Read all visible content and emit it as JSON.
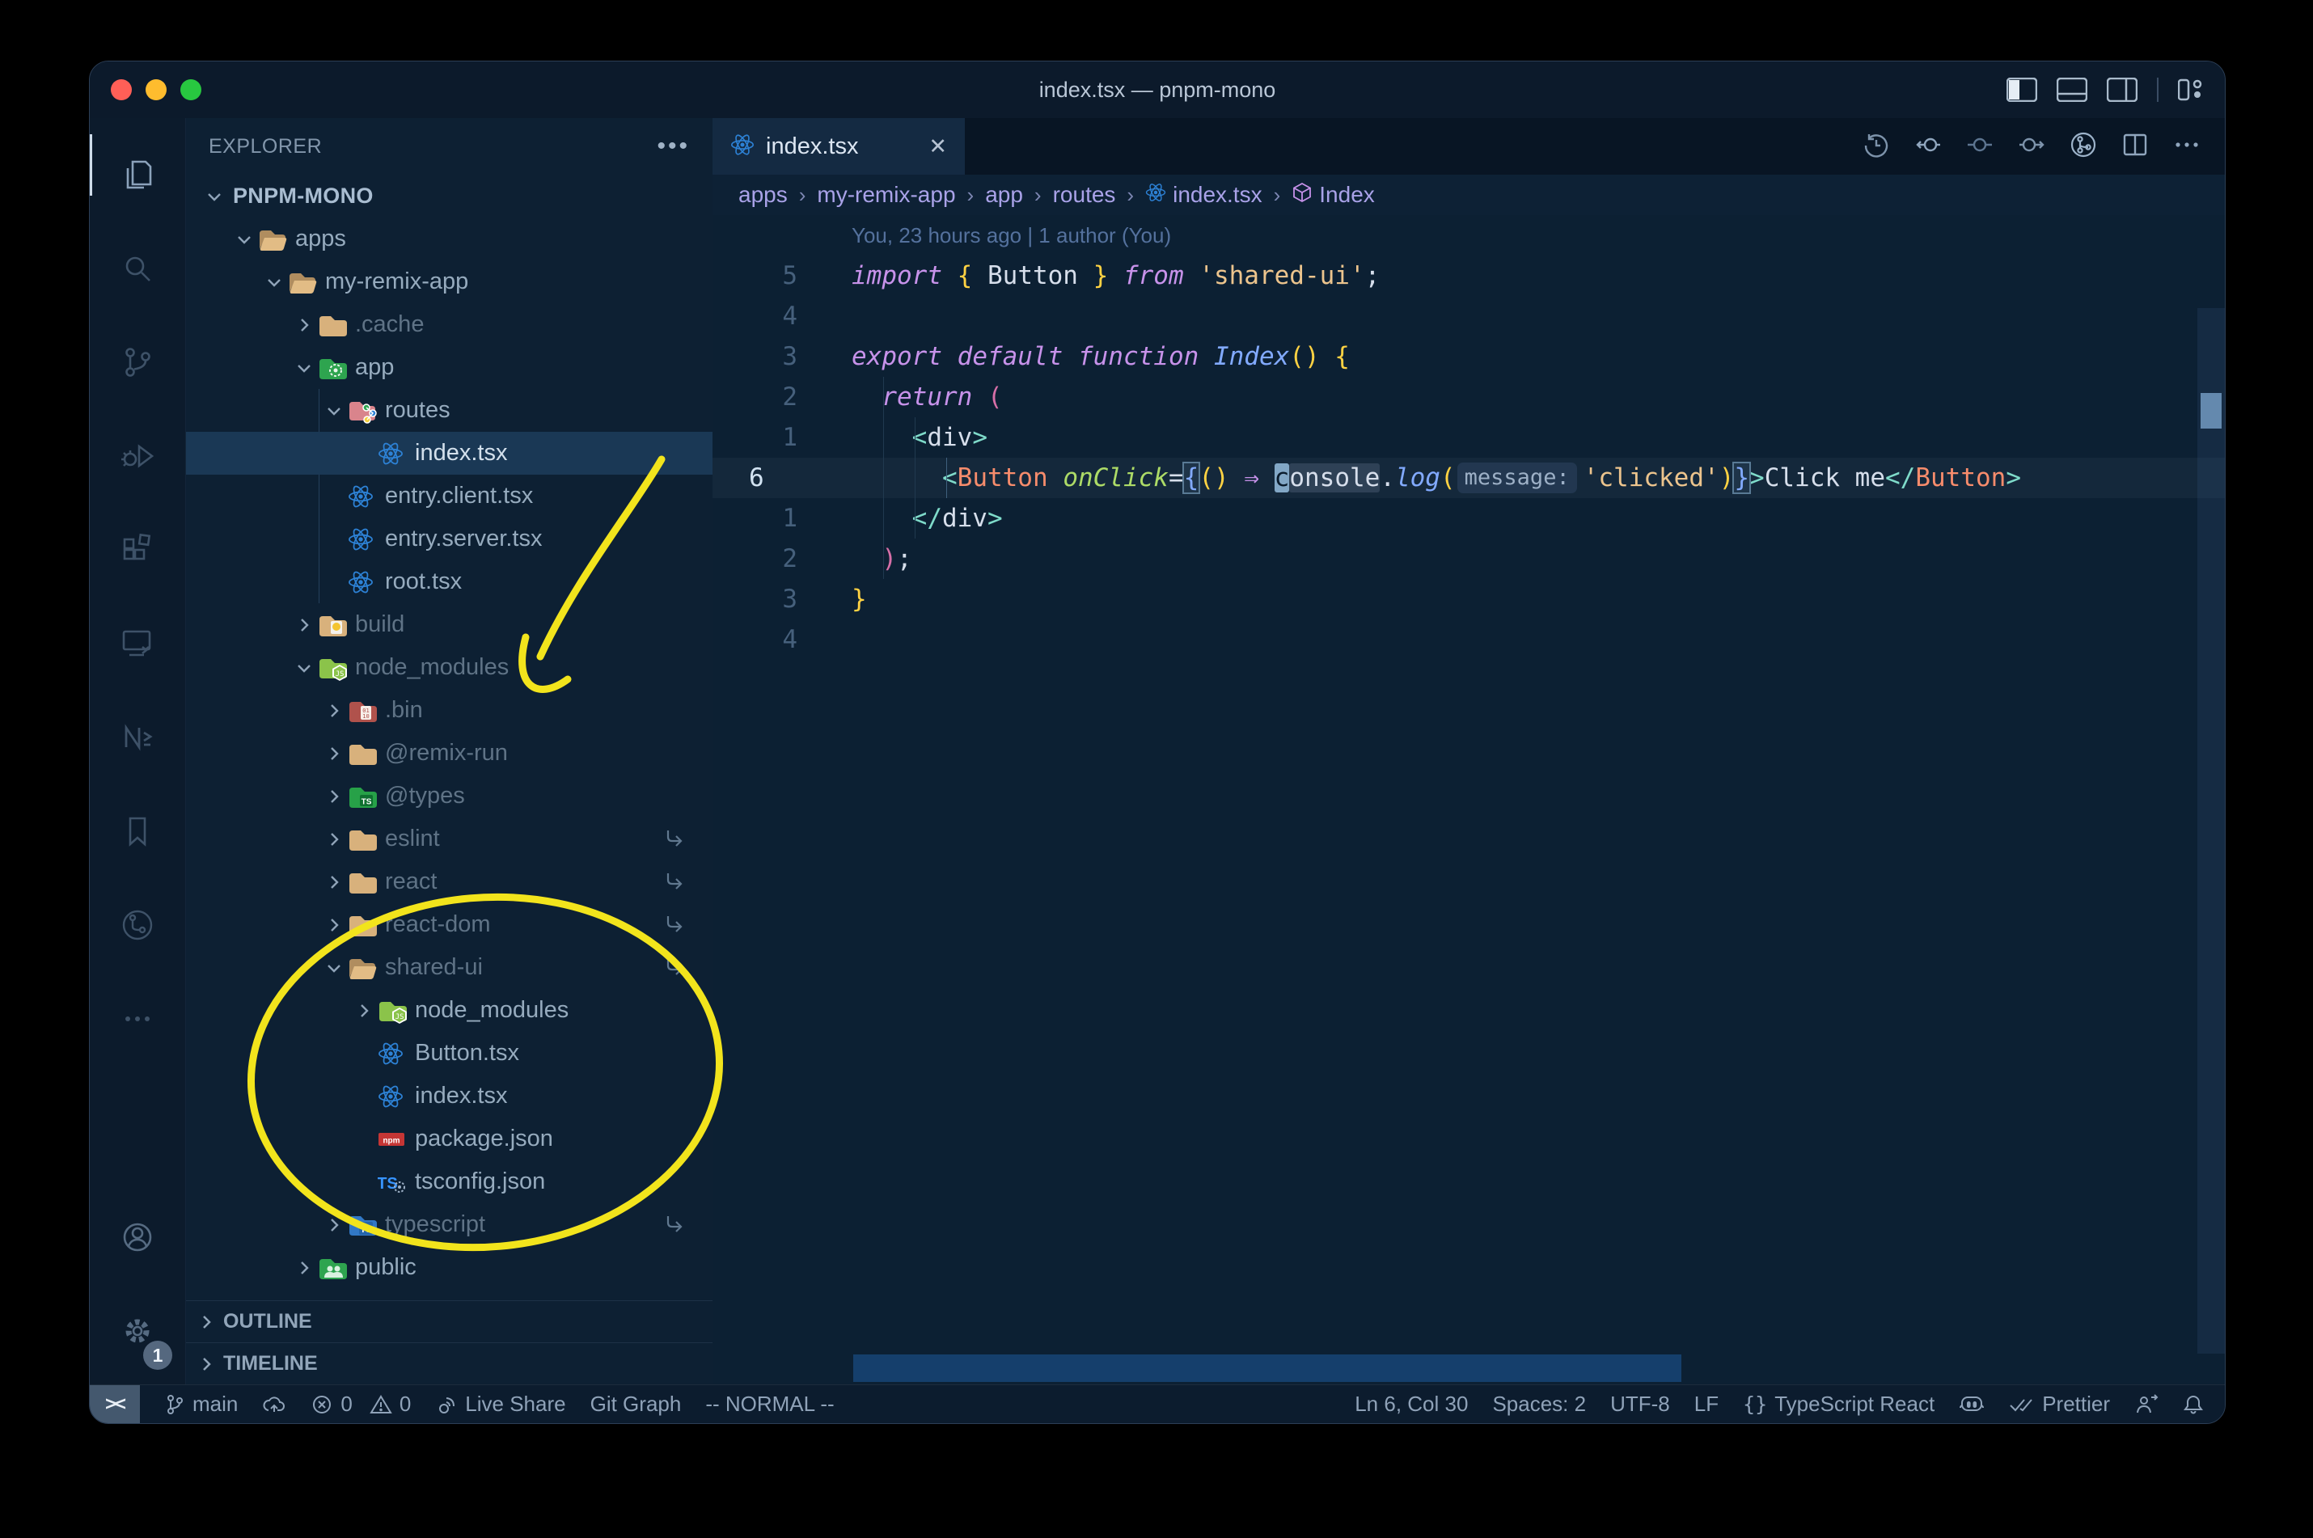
{
  "window": {
    "title": "index.tsx — pnpm-mono"
  },
  "traffic_lights": {
    "close": "#ff5f57",
    "minimize": "#febc2e",
    "zoom": "#28c840"
  },
  "titlebar_icons": [
    "toggle-sidebar-icon",
    "toggle-panel-icon",
    "toggle-secondary-sidebar-icon",
    "customize-layout-icon"
  ],
  "activity_bar": {
    "top": [
      "explorer",
      "search",
      "source-control",
      "run-debug",
      "extensions",
      "remote-explorer",
      "nx-console",
      "bookmarks",
      "git-graph",
      "more"
    ],
    "bottom": [
      "account",
      "settings"
    ],
    "settings_badge": "1"
  },
  "sidebar": {
    "header": "EXPLORER",
    "sections": {
      "outline": "OUTLINE",
      "timeline": "TIMELINE"
    },
    "tree": [
      {
        "label": "PNPM-MONO",
        "depth": 0,
        "chevron": "down",
        "icon": null,
        "bold": true
      },
      {
        "label": "apps",
        "depth": 1,
        "chevron": "down",
        "icon": "folder-open"
      },
      {
        "label": "my-remix-app",
        "depth": 2,
        "chevron": "down",
        "icon": "folder-open"
      },
      {
        "label": ".cache",
        "depth": 3,
        "chevron": "right",
        "icon": "folder",
        "dim": true
      },
      {
        "label": "app",
        "depth": 3,
        "chevron": "down",
        "icon": "folder-app"
      },
      {
        "label": "routes",
        "depth": 4,
        "chevron": "down",
        "icon": "folder-routes"
      },
      {
        "label": "index.tsx",
        "depth": 5,
        "chevron": null,
        "icon": "react",
        "selected": true
      },
      {
        "label": "entry.client.tsx",
        "depth": 4,
        "chevron": null,
        "icon": "react"
      },
      {
        "label": "entry.server.tsx",
        "depth": 4,
        "chevron": null,
        "icon": "react"
      },
      {
        "label": "root.tsx",
        "depth": 4,
        "chevron": null,
        "icon": "react"
      },
      {
        "label": "build",
        "depth": 3,
        "chevron": "right",
        "icon": "folder-build",
        "dim": true
      },
      {
        "label": "node_modules",
        "depth": 3,
        "chevron": "down",
        "icon": "folder-node",
        "dim": true
      },
      {
        "label": ".bin",
        "depth": 4,
        "chevron": "right",
        "icon": "folder-bin",
        "dim": true
      },
      {
        "label": "@remix-run",
        "depth": 4,
        "chevron": "right",
        "icon": "folder",
        "dim": true
      },
      {
        "label": "@types",
        "depth": 4,
        "chevron": "right",
        "icon": "folder-types",
        "dim": true
      },
      {
        "label": "eslint",
        "depth": 4,
        "chevron": "right",
        "icon": "folder",
        "dim": true,
        "symlink": true
      },
      {
        "label": "react",
        "depth": 4,
        "chevron": "right",
        "icon": "folder",
        "dim": true,
        "symlink": true
      },
      {
        "label": "react-dom",
        "depth": 4,
        "chevron": "right",
        "icon": "folder",
        "dim": true,
        "symlink": true
      },
      {
        "label": "shared-ui",
        "depth": 4,
        "chevron": "down",
        "icon": "folder-open",
        "dim": true,
        "symlink": true
      },
      {
        "label": "node_modules",
        "depth": 5,
        "chevron": "right",
        "icon": "folder-node"
      },
      {
        "label": "Button.tsx",
        "depth": 5,
        "chevron": null,
        "icon": "react"
      },
      {
        "label": "index.tsx",
        "depth": 5,
        "chevron": null,
        "icon": "react"
      },
      {
        "label": "package.json",
        "depth": 5,
        "chevron": null,
        "icon": "npm"
      },
      {
        "label": "tsconfig.json",
        "depth": 5,
        "chevron": null,
        "icon": "tsconfig"
      },
      {
        "label": "typescript",
        "depth": 4,
        "chevron": "right",
        "icon": "folder-ts",
        "dim": true,
        "symlink": true
      },
      {
        "label": "public",
        "depth": 3,
        "chevron": "right",
        "icon": "folder-public"
      }
    ]
  },
  "editor": {
    "tab": {
      "label": "index.tsx",
      "icon": "react",
      "close": "✕"
    },
    "actions": [
      "history-icon",
      "nav-back-icon",
      "nav-dot-icon",
      "nav-forward-icon",
      "git-branch-circle-icon",
      "split-editor-icon",
      "more-actions-icon"
    ],
    "breadcrumbs": [
      {
        "label": "apps"
      },
      {
        "label": "my-remix-app"
      },
      {
        "label": "app"
      },
      {
        "label": "routes"
      },
      {
        "label": "index.tsx",
        "icon": "react"
      },
      {
        "label": "Index",
        "icon": "symbol-cube"
      }
    ],
    "lines": [
      {
        "blame": "You, 23 hours ago | 1 author (You)"
      },
      {
        "gutter": "5",
        "segs": [
          [
            "import",
            "kw"
          ],
          [
            " ",
            "fg"
          ],
          [
            "{",
            "gold"
          ],
          [
            " Button ",
            "fg"
          ],
          [
            "}",
            "gold"
          ],
          [
            " ",
            "fg"
          ],
          [
            "from",
            "kw"
          ],
          [
            " ",
            "fg"
          ],
          [
            "'shared-ui'",
            "str"
          ],
          [
            ";",
            "fg"
          ]
        ]
      },
      {
        "gutter": "4",
        "segs": []
      },
      {
        "gutter": "3",
        "segs": [
          [
            "export",
            "kw"
          ],
          [
            " ",
            "fg"
          ],
          [
            "default",
            "kw"
          ],
          [
            " ",
            "fg"
          ],
          [
            "function",
            "kw"
          ],
          [
            " ",
            "fg"
          ],
          [
            "Index",
            "fn"
          ],
          [
            "()",
            "gold"
          ],
          [
            " ",
            "fg"
          ],
          [
            "{",
            "gold"
          ]
        ]
      },
      {
        "gutter": "2",
        "segs": [
          [
            "  ",
            "fg"
          ],
          [
            "return",
            "kw"
          ],
          [
            " ",
            "fg"
          ],
          [
            "(",
            "pink"
          ]
        ]
      },
      {
        "gutter": "1",
        "segs": [
          [
            "    ",
            "fg"
          ],
          [
            "<",
            "teal"
          ],
          [
            "div",
            "fg"
          ],
          [
            ">",
            "teal"
          ]
        ]
      },
      {
        "gutter": "6",
        "current": true,
        "segs": [
          [
            "      ",
            "fg"
          ],
          [
            "<",
            "teal"
          ],
          [
            "Button",
            "comp"
          ],
          [
            " ",
            "fg"
          ],
          [
            "onClick",
            "attr"
          ],
          [
            "=",
            "fg"
          ],
          [
            "{",
            "brace"
          ],
          [
            "()",
            "gold"
          ],
          [
            " ",
            "fg"
          ],
          [
            "⇒",
            "kw"
          ],
          [
            " ",
            "fg"
          ],
          [
            "c",
            "cursor"
          ],
          [
            "onsole",
            "fg hl"
          ],
          [
            ".",
            "fg"
          ],
          [
            "log",
            "fn"
          ],
          [
            "(",
            "gold"
          ],
          [
            "message:",
            "inlay"
          ],
          [
            "'clicked'",
            "str"
          ],
          [
            ")",
            "gold"
          ],
          [
            "}",
            "brace"
          ],
          [
            ">",
            "teal"
          ],
          [
            "Click me",
            "fg"
          ],
          [
            "</",
            "teal"
          ],
          [
            "Button",
            "comp"
          ],
          [
            ">",
            "teal"
          ]
        ]
      },
      {
        "gutter": "1",
        "segs": [
          [
            "    ",
            "fg"
          ],
          [
            "</",
            "teal"
          ],
          [
            "div",
            "fg"
          ],
          [
            ">",
            "teal"
          ]
        ]
      },
      {
        "gutter": "2",
        "segs": [
          [
            "  ",
            "fg"
          ],
          [
            ")",
            "pink"
          ],
          [
            ";",
            "fg"
          ]
        ]
      },
      {
        "gutter": "3",
        "segs": [
          [
            "}",
            "gold"
          ]
        ]
      },
      {
        "gutter": "4",
        "segs": []
      }
    ]
  },
  "status_bar": {
    "left": [
      {
        "icon": "remote",
        "label": "><",
        "name": "remote-indicator"
      },
      {
        "icon": "git-branch",
        "label": "main",
        "name": "branch-status"
      },
      {
        "icon": "cloud-upload",
        "label": "",
        "name": "publish-status"
      },
      {
        "icon": "error",
        "label": "0",
        "icon2": "warning",
        "label2": "0",
        "name": "problems-status"
      },
      {
        "icon": "live-share",
        "label": "Live Share",
        "name": "live-share-status"
      },
      {
        "icon": null,
        "label": "Git Graph",
        "name": "git-graph-status"
      },
      {
        "icon": null,
        "label": "-- NORMAL --",
        "name": "vim-mode-status"
      }
    ],
    "right": [
      {
        "icon": null,
        "label": "Ln 6, Col 30",
        "name": "cursor-position"
      },
      {
        "icon": null,
        "label": "Spaces: 2",
        "name": "indentation-status"
      },
      {
        "icon": null,
        "label": "UTF-8",
        "name": "encoding-status"
      },
      {
        "icon": null,
        "label": "LF",
        "name": "eol-status"
      },
      {
        "icon": "braces",
        "label": "TypeScript React",
        "name": "language-mode"
      },
      {
        "icon": "copilot",
        "label": "",
        "name": "copilot-status"
      },
      {
        "icon": "double-check",
        "label": "Prettier",
        "name": "prettier-status"
      },
      {
        "icon": "person-feedback",
        "label": "",
        "name": "feedback-button"
      },
      {
        "icon": "bell",
        "label": "",
        "name": "notifications-bell"
      }
    ]
  },
  "annotations": {
    "color": "#f2e41c"
  },
  "colors": {
    "editor_bg": "#0c2033",
    "sidebar_bg": "#0d2033",
    "titlebar_bg": "#0c1a2b",
    "tabstrip_bg": "#081524",
    "active_tab_bg": "#142a42",
    "statusbar_bg": "#0c1c2e",
    "selection_row": "#1a3855",
    "accent_string": "#ecc48d",
    "accent_keyword": "#c792ea",
    "accent_tag": "#7fdbca",
    "accent_component": "#f78c6c",
    "accent_attr": "#addb67",
    "accent_fn": "#82aaff",
    "annotation_yellow": "#f2e41c"
  }
}
